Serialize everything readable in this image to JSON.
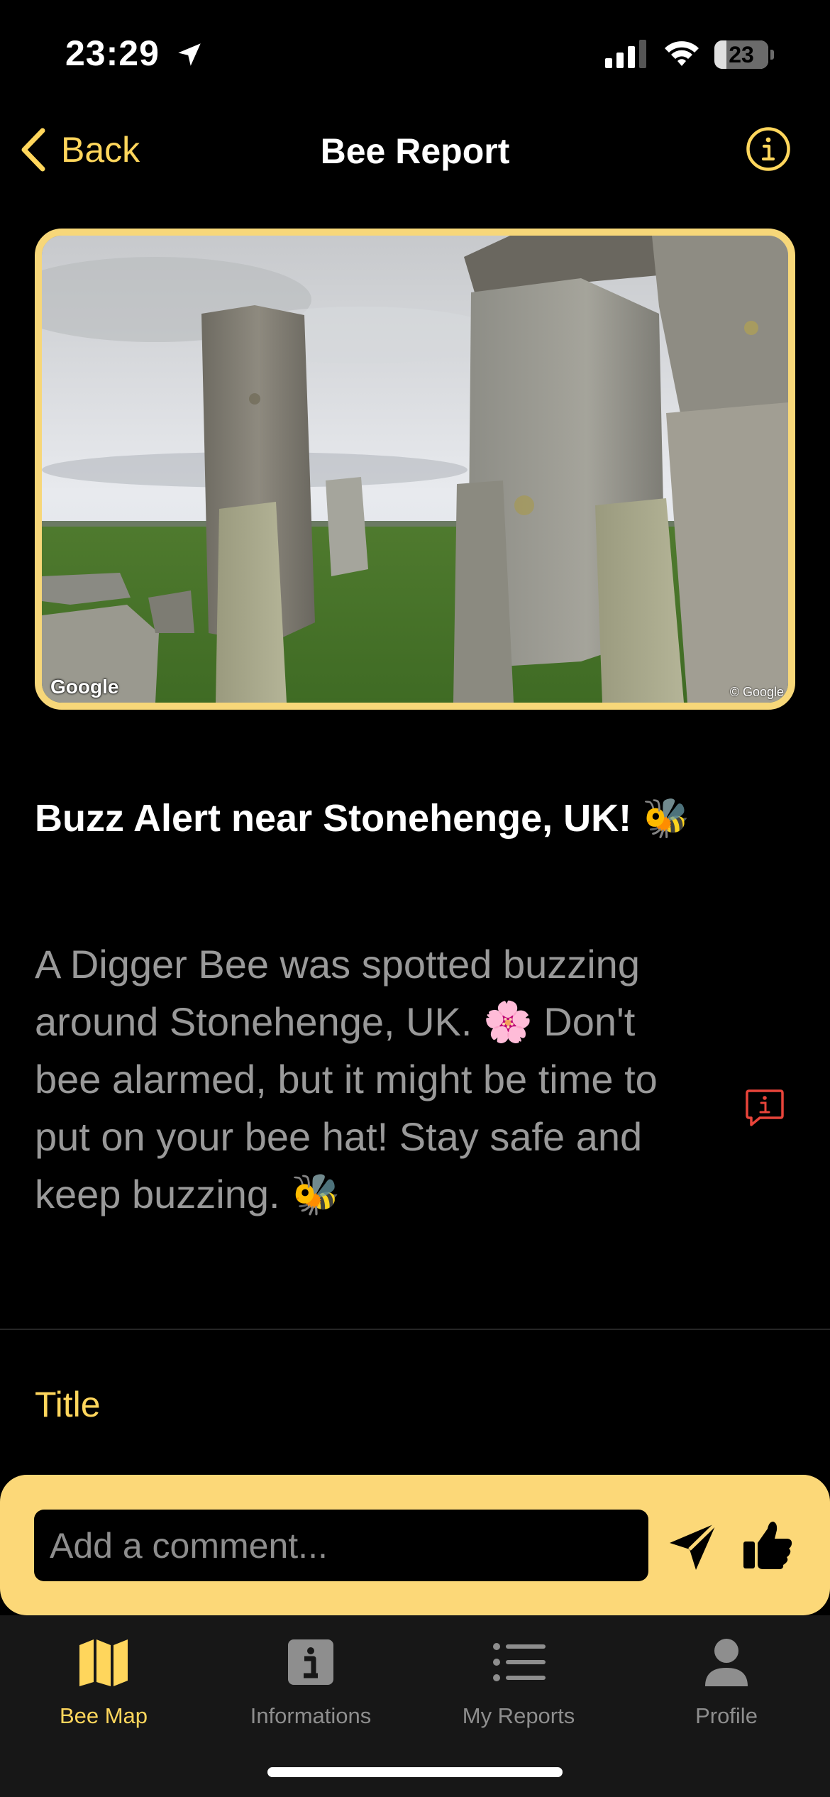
{
  "status_bar": {
    "time": "23:29",
    "battery": "23",
    "battery_fraction": 0.23
  },
  "nav": {
    "back_label": "Back",
    "title": "Bee Report"
  },
  "photo": {
    "watermark": "Google",
    "copyright": "© Google"
  },
  "report": {
    "title": "Buzz Alert near Stonehenge, UK! 🐝",
    "description": "A Digger Bee was spotted buzzing around Stonehenge, UK. 🌸 Don't bee alarmed, but it might be time to put on your bee hat! Stay safe and keep buzzing. 🐝"
  },
  "form": {
    "field_label": "Title"
  },
  "comment": {
    "placeholder": "Add a comment..."
  },
  "tabs": [
    {
      "label": "Bee Map",
      "icon": "map-icon"
    },
    {
      "label": "Informations",
      "icon": "info-square-icon"
    },
    {
      "label": "My Reports",
      "icon": "list-icon"
    },
    {
      "label": "Profile",
      "icon": "person-icon"
    }
  ],
  "colors": {
    "accent": "#ffd65c",
    "comment_bar": "#fcd878",
    "tab_inactive": "#8e8e8e",
    "flag": "#e8443a"
  }
}
